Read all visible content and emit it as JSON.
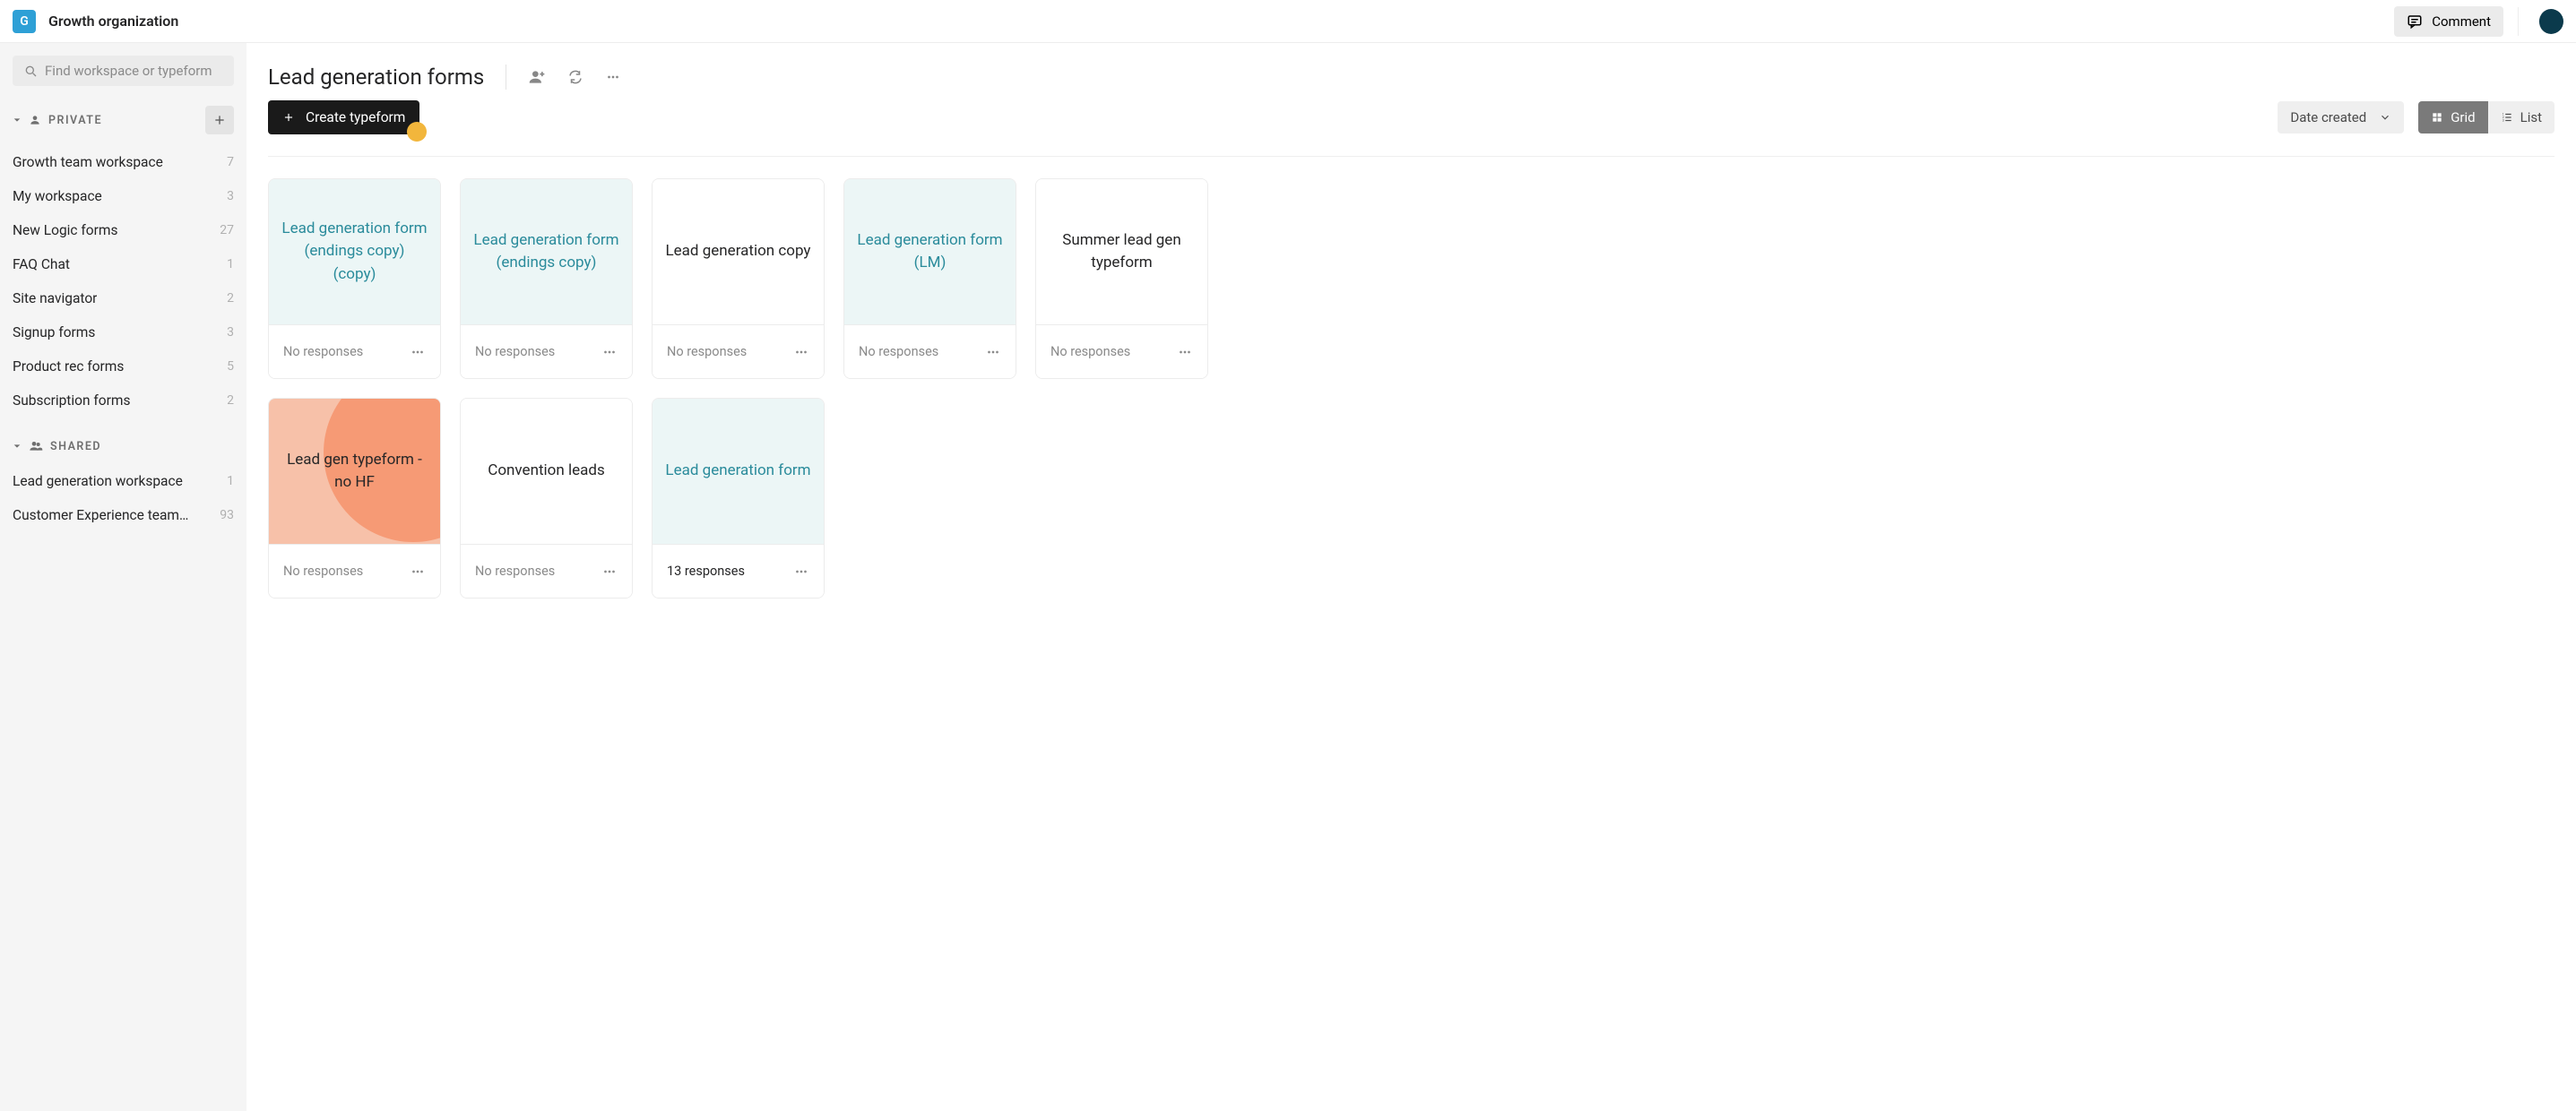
{
  "org": {
    "badge": "G",
    "name": "Growth organization"
  },
  "topbar": {
    "comment_label": "Comment"
  },
  "sidebar": {
    "search_placeholder": "Find workspace or typeform",
    "private_label": "PRIVATE",
    "shared_label": "SHARED",
    "private_items": [
      {
        "label": "Growth team workspace",
        "count": "7"
      },
      {
        "label": "My workspace",
        "count": "3"
      },
      {
        "label": "New Logic forms",
        "count": "27"
      },
      {
        "label": "FAQ Chat",
        "count": "1"
      },
      {
        "label": "Site navigator",
        "count": "2"
      },
      {
        "label": "Signup forms",
        "count": "3"
      },
      {
        "label": "Product rec forms",
        "count": "5"
      },
      {
        "label": "Subscription forms",
        "count": "2"
      }
    ],
    "shared_items": [
      {
        "label": "Lead generation workspace",
        "count": "1"
      },
      {
        "label": "Customer Experience team …",
        "count": "93"
      }
    ]
  },
  "main": {
    "title": "Lead generation forms",
    "create_label": "Create typeform",
    "sort_label": "Date created",
    "grid_label": "Grid",
    "list_label": "List"
  },
  "cards": [
    {
      "title": "Lead generation form (endings copy) (copy)",
      "responses": "No responses",
      "bg": "teal",
      "has": false
    },
    {
      "title": "Lead generation form (endings copy)",
      "responses": "No responses",
      "bg": "teal",
      "has": false
    },
    {
      "title": "Lead generation copy",
      "responses": "No responses",
      "bg": "white",
      "has": false
    },
    {
      "title": "Lead generation form (LM)",
      "responses": "No responses",
      "bg": "teal",
      "has": false
    },
    {
      "title": "Summer lead gen typeform",
      "responses": "No responses",
      "bg": "white",
      "has": false
    },
    {
      "title": "Lead gen typeform - no HF",
      "responses": "No responses",
      "bg": "orange",
      "has": false
    },
    {
      "title": "Convention leads",
      "responses": "No responses",
      "bg": "white",
      "has": false
    },
    {
      "title": "Lead generation form",
      "responses": "13 responses",
      "bg": "teal",
      "has": true
    }
  ]
}
